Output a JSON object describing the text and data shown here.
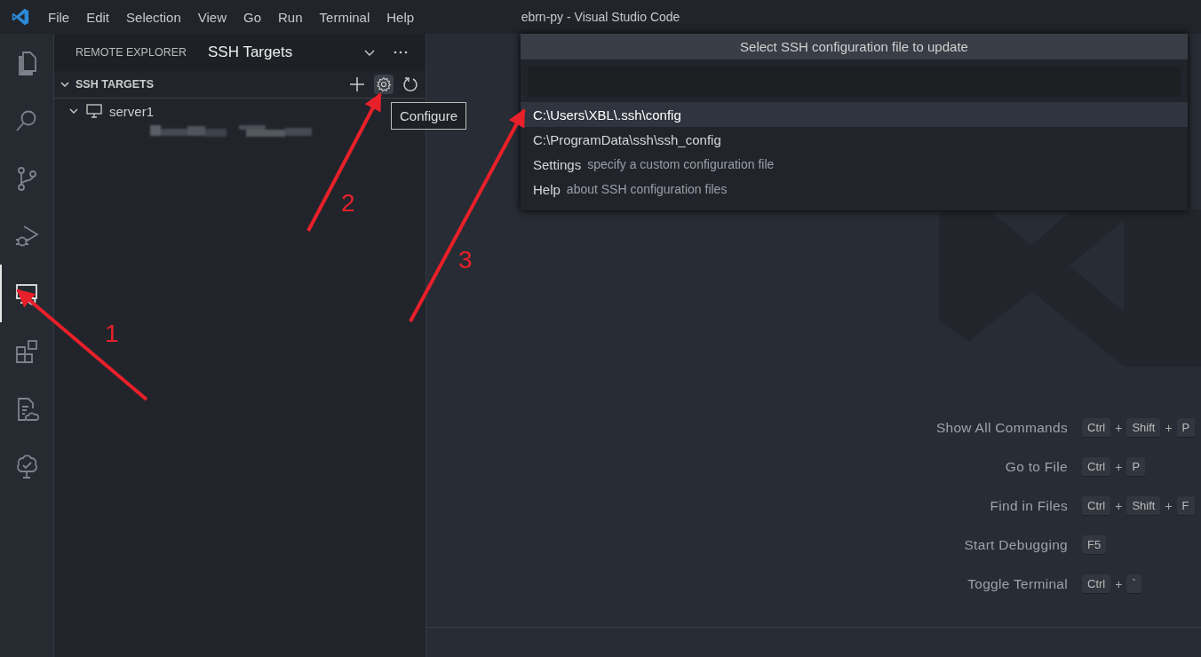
{
  "window": {
    "title": "ebrn-py - Visual Studio Code"
  },
  "menu": [
    "File",
    "Edit",
    "Selection",
    "View",
    "Go",
    "Run",
    "Terminal",
    "Help"
  ],
  "activity_bar": [
    {
      "kind": "files",
      "selected": false
    },
    {
      "kind": "search",
      "selected": false
    },
    {
      "kind": "source-control",
      "selected": false
    },
    {
      "kind": "run",
      "selected": false
    },
    {
      "kind": "remote",
      "selected": true
    },
    {
      "kind": "extensions",
      "selected": false
    },
    {
      "kind": "document-cloud",
      "selected": false
    },
    {
      "kind": "tree",
      "selected": false
    }
  ],
  "sidebar": {
    "title": "REMOTE EXPLORER",
    "view": "SSH Targets",
    "section": {
      "title": "SSH TARGETS",
      "expanded": true
    },
    "tree": [
      {
        "label": "server1",
        "expanded": true
      }
    ],
    "tooltip": "Configure"
  },
  "quick_pick": {
    "title": "Select SSH configuration file to update",
    "items": [
      {
        "label": "C:\\Users\\XBL\\.ssh\\config",
        "selected": true
      },
      {
        "label": "C:\\ProgramData\\ssh\\ssh_config",
        "selected": false
      },
      {
        "label": "Settings",
        "description": "specify a custom configuration file",
        "selected": false
      },
      {
        "label": "Help",
        "description": "about SSH configuration files",
        "selected": false
      }
    ]
  },
  "shortcuts": [
    {
      "label": "Show All Commands",
      "keys": [
        {
          "kind": "key",
          "text": "Ctrl"
        },
        {
          "kind": "sep",
          "text": "+"
        },
        {
          "kind": "key",
          "text": "Shift"
        },
        {
          "kind": "sep",
          "text": "+"
        },
        {
          "kind": "key",
          "text": "P"
        }
      ]
    },
    {
      "label": "Go to File",
      "keys": [
        {
          "kind": "key",
          "text": "Ctrl"
        },
        {
          "kind": "sep",
          "text": "+"
        },
        {
          "kind": "key",
          "text": "P"
        }
      ]
    },
    {
      "label": "Find in Files",
      "keys": [
        {
          "kind": "key",
          "text": "Ctrl"
        },
        {
          "kind": "sep",
          "text": "+"
        },
        {
          "kind": "key",
          "text": "Shift"
        },
        {
          "kind": "sep",
          "text": "+"
        },
        {
          "kind": "key",
          "text": "F"
        }
      ]
    },
    {
      "label": "Start Debugging",
      "keys": [
        {
          "kind": "key",
          "text": "F5"
        }
      ]
    },
    {
      "label": "Toggle Terminal",
      "keys": [
        {
          "kind": "key",
          "text": "Ctrl"
        },
        {
          "kind": "sep",
          "text": "+"
        },
        {
          "kind": "key",
          "text": "`"
        }
      ]
    }
  ],
  "annotations": [
    {
      "label": "1"
    },
    {
      "label": "2"
    },
    {
      "label": "3"
    }
  ]
}
